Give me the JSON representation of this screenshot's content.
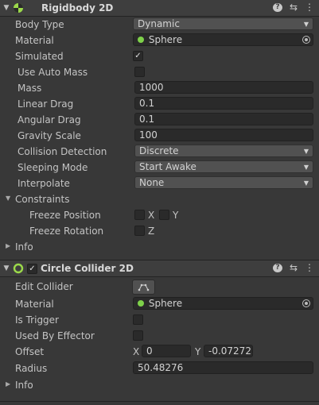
{
  "rigidbody": {
    "title": "Rigidbody 2D",
    "body_type": {
      "label": "Body Type",
      "value": "Dynamic"
    },
    "material": {
      "label": "Material",
      "value": "Sphere"
    },
    "simulated": {
      "label": "Simulated",
      "checked": true
    },
    "use_auto_mass": {
      "label": "Use Auto Mass",
      "checked": false
    },
    "mass": {
      "label": "Mass",
      "value": "1000"
    },
    "linear_drag": {
      "label": "Linear Drag",
      "value": "0.1"
    },
    "angular_drag": {
      "label": "Angular Drag",
      "value": "0.1"
    },
    "gravity_scale": {
      "label": "Gravity Scale",
      "value": "100"
    },
    "collision_detection": {
      "label": "Collision Detection",
      "value": "Discrete"
    },
    "sleeping_mode": {
      "label": "Sleeping Mode",
      "value": "Start Awake"
    },
    "interpolate": {
      "label": "Interpolate",
      "value": "None"
    },
    "constraints": {
      "label": "Constraints",
      "freeze_position": {
        "label": "Freeze Position",
        "x_label": "X",
        "y_label": "Y"
      },
      "freeze_rotation": {
        "label": "Freeze Rotation",
        "z_label": "Z"
      }
    },
    "info_label": "Info"
  },
  "circle_collider": {
    "title": "Circle Collider 2D",
    "enabled": true,
    "edit_collider": {
      "label": "Edit Collider"
    },
    "material": {
      "label": "Material",
      "value": "Sphere"
    },
    "is_trigger": {
      "label": "Is Trigger",
      "checked": false
    },
    "used_by_effector": {
      "label": "Used By Effector",
      "checked": false
    },
    "offset": {
      "label": "Offset",
      "x_label": "X",
      "x_value": "0",
      "y_label": "Y",
      "y_value": "-0.072723"
    },
    "radius": {
      "label": "Radius",
      "value": "50.48276"
    },
    "info_label": "Info"
  },
  "icons": {
    "check": "✓",
    "help": "?",
    "presets": "⇆",
    "menu": "⋮",
    "fold_open": "▼",
    "fold_closed": "▶",
    "dropdown": "▼"
  }
}
